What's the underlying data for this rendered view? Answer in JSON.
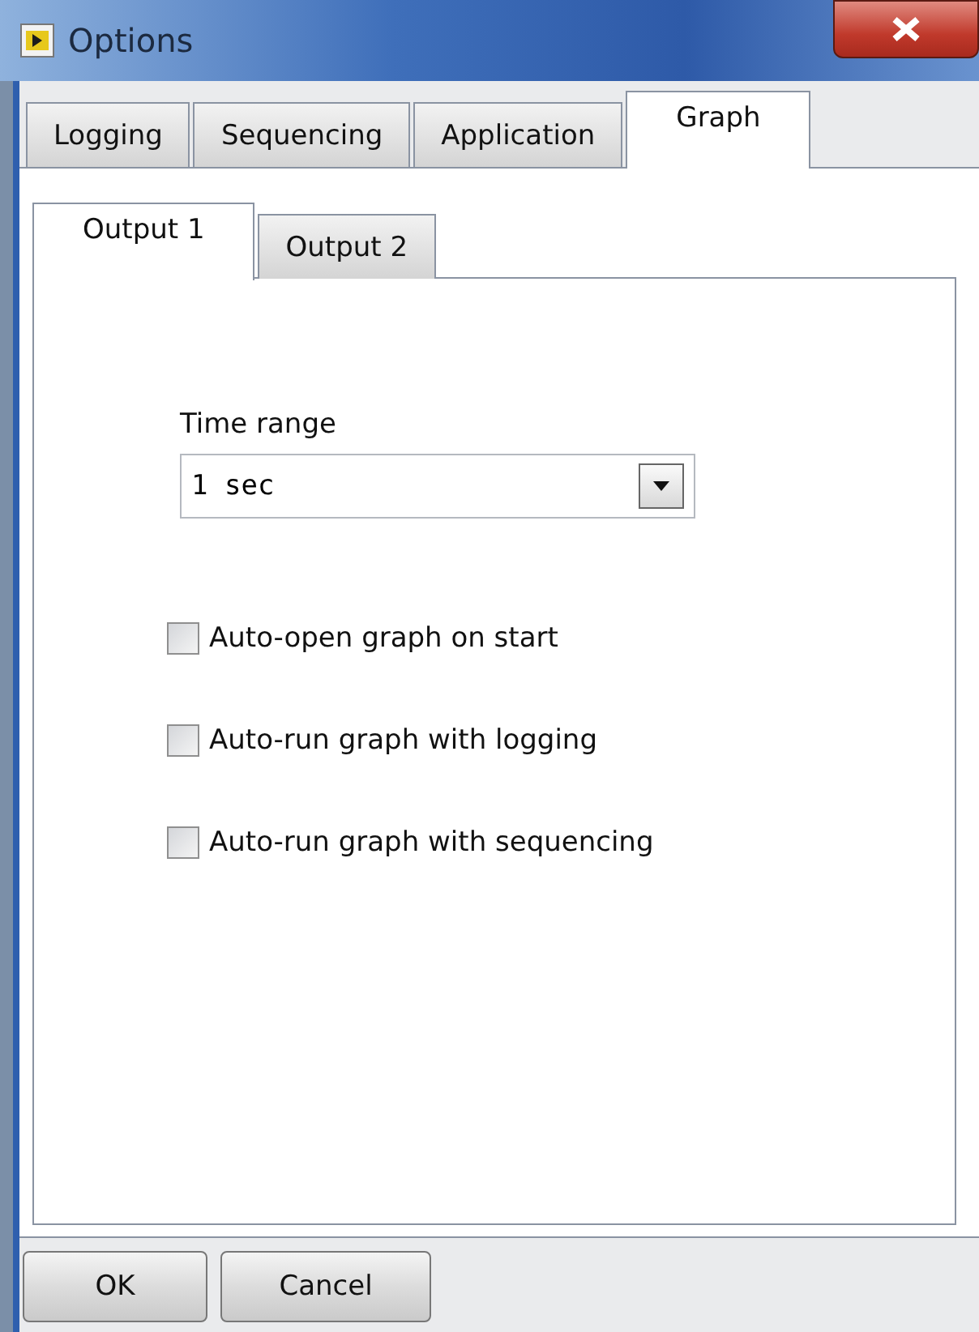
{
  "window": {
    "title": "Options"
  },
  "tabs": [
    {
      "label": "Logging",
      "selected": false
    },
    {
      "label": "Sequencing",
      "selected": false
    },
    {
      "label": "Application",
      "selected": false
    },
    {
      "label": "Graph",
      "selected": true
    }
  ],
  "subtabs": [
    {
      "label": "Output 1",
      "selected": true
    },
    {
      "label": "Output 2",
      "selected": false
    }
  ],
  "time_range": {
    "label": "Time range",
    "value": "1 sec"
  },
  "options": [
    {
      "label": "Auto-open graph on start",
      "checked": false
    },
    {
      "label": "Auto-run graph with logging",
      "checked": false
    },
    {
      "label": "Auto-run graph with sequencing",
      "checked": false
    }
  ],
  "buttons": [
    "OK",
    "Cancel"
  ]
}
